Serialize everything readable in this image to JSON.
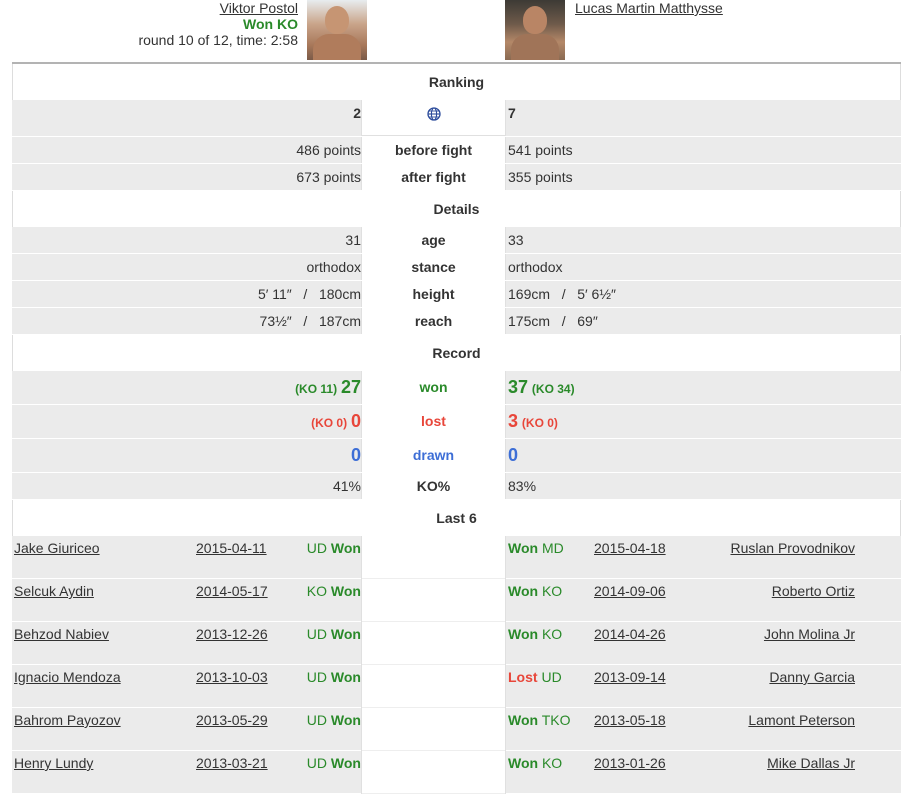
{
  "header": {
    "left": {
      "name": "Viktor Postol",
      "result": "Won KO",
      "detail": "round 10 of 12, time: 2:58"
    },
    "right": {
      "name": "Lucas Martin Matthysse"
    }
  },
  "sections": {
    "ranking": "Ranking",
    "details": "Details",
    "record": "Record",
    "last6": "Last 6"
  },
  "ranking": {
    "left_rank": "2",
    "right_rank": "7",
    "world_icon": "globe-icon",
    "before": {
      "label": "before fight",
      "left": "486 points",
      "right": "541 points"
    },
    "after": {
      "label": "after fight",
      "left": "673 points",
      "right": "355 points"
    }
  },
  "details": {
    "age": {
      "label": "age",
      "left": "31",
      "right": "33"
    },
    "stance": {
      "label": "stance",
      "left": "orthodox",
      "right": "orthodox"
    },
    "height": {
      "label": "height",
      "left": "5′ 11″   /   180cm",
      "right": "169cm   /   5′ 6½″"
    },
    "reach": {
      "label": "reach",
      "left": "73½″   /   187cm",
      "right": "175cm   /   69″"
    }
  },
  "record": {
    "won": {
      "label": "won",
      "left_ko": "(KO 11)",
      "left": "27",
      "right": "37",
      "right_ko": "(KO 34)"
    },
    "lost": {
      "label": "lost",
      "left_ko": "(KO 0)",
      "left": "0",
      "right": "3",
      "right_ko": "(KO 0)"
    },
    "drawn": {
      "label": "drawn",
      "left": "0",
      "right": "0"
    },
    "ko_pct": {
      "label": "KO%",
      "left": "41%",
      "right": "83%"
    }
  },
  "colors": {
    "won": "#2a8a2a",
    "lost": "#e8463a",
    "drawn": "#3d6ed6"
  },
  "last6": {
    "left": [
      {
        "opponent": "Jake Giuriceo",
        "date": "2015-04-11",
        "method": "UD",
        "result": "Won"
      },
      {
        "opponent": "Selcuk Aydin",
        "date": "2014-05-17",
        "method": "KO",
        "result": "Won"
      },
      {
        "opponent": "Behzod Nabiev",
        "date": "2013-12-26",
        "method": "UD",
        "result": "Won"
      },
      {
        "opponent": "Ignacio Mendoza",
        "date": "2013-10-03",
        "method": "UD",
        "result": "Won"
      },
      {
        "opponent": "Bahrom Payozov",
        "date": "2013-05-29",
        "method": "UD",
        "result": "Won"
      },
      {
        "opponent": "Henry Lundy",
        "date": "2013-03-21",
        "method": "UD",
        "result": "Won"
      }
    ],
    "right": [
      {
        "result": "Won",
        "method": "MD",
        "date": "2015-04-18",
        "opponent": "Ruslan Provodnikov"
      },
      {
        "result": "Won",
        "method": "KO",
        "date": "2014-09-06",
        "opponent": "Roberto Ortiz"
      },
      {
        "result": "Won",
        "method": "KO",
        "date": "2014-04-26",
        "opponent": "John Molina Jr"
      },
      {
        "result": "Lost",
        "method": "UD",
        "date": "2013-09-14",
        "opponent": "Danny Garcia"
      },
      {
        "result": "Won",
        "method": "TKO",
        "date": "2013-05-18",
        "opponent": "Lamont Peterson"
      },
      {
        "result": "Won",
        "method": "KO",
        "date": "2013-01-26",
        "opponent": "Mike Dallas Jr"
      }
    ]
  }
}
